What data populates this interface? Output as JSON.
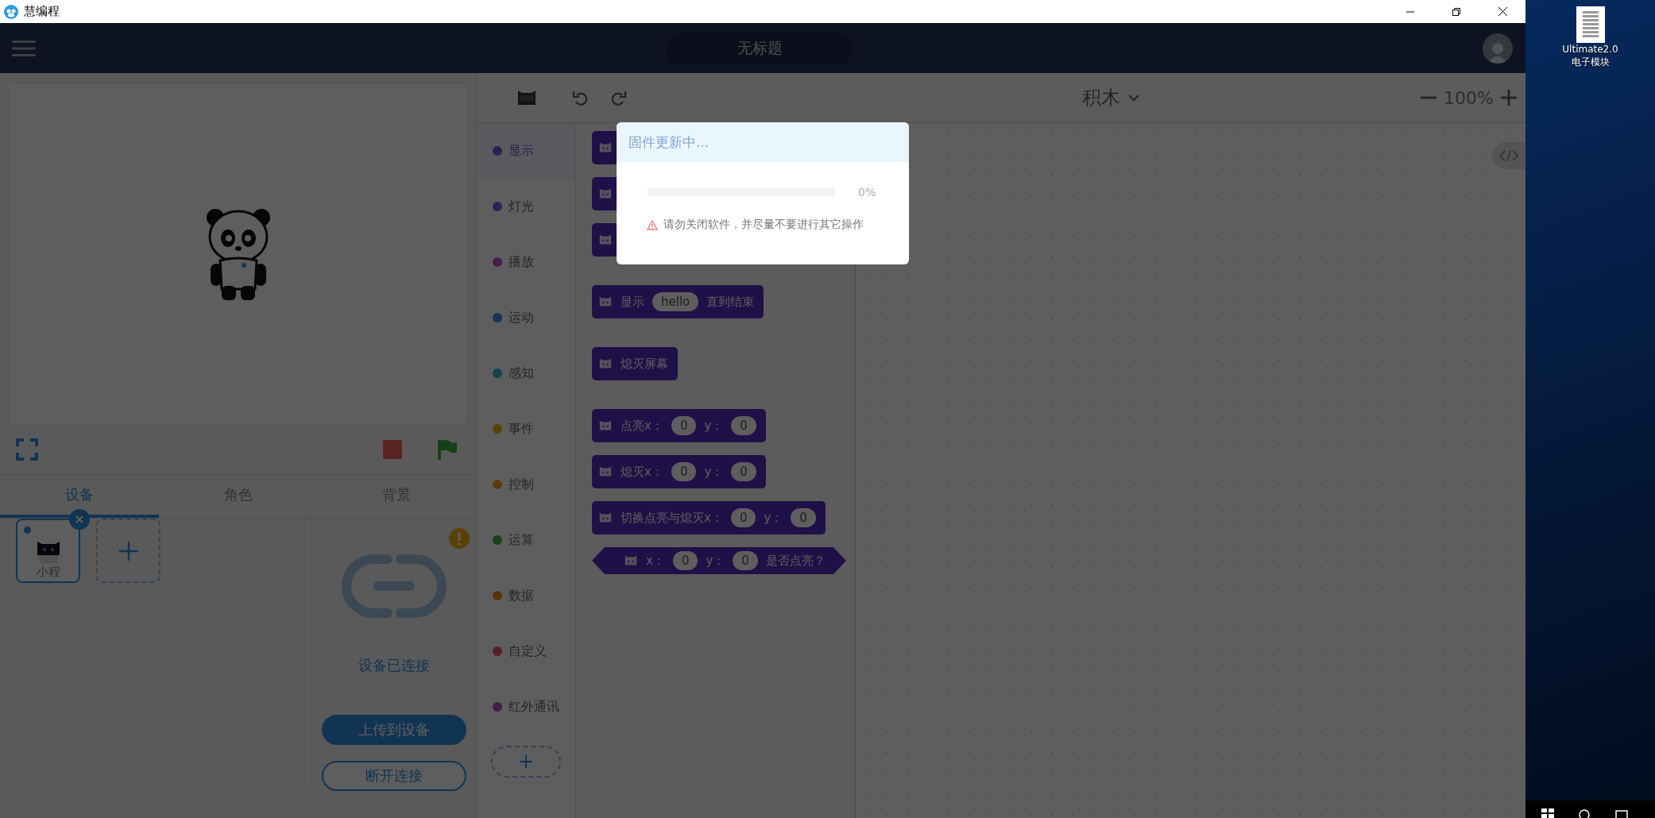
{
  "title_bar": {
    "app_name": "慧编程"
  },
  "header": {
    "project_title": "无标题"
  },
  "stage_tabs": [
    {
      "label": "设备",
      "selected": true
    },
    {
      "label": "角色",
      "selected": false
    },
    {
      "label": "背景",
      "selected": false
    }
  ],
  "devices": [
    {
      "name": "小程",
      "selected": true
    }
  ],
  "connection": {
    "status": "设备已连接",
    "buttons": [
      {
        "label": "上传到设备",
        "kind": "primary"
      },
      {
        "label": "断开连接",
        "kind": "outline"
      }
    ]
  },
  "categories": [
    {
      "label": "显示",
      "color": "#2d1f53",
      "selected": true
    },
    {
      "label": "灯光",
      "color": "#302055",
      "selected": false
    },
    {
      "label": "播放",
      "color": "#4a1d44",
      "selected": false
    },
    {
      "label": "运动",
      "color": "#153456",
      "selected": false
    },
    {
      "label": "感知",
      "color": "#13434d",
      "selected": false
    },
    {
      "label": "事件",
      "color": "#594300",
      "selected": false
    },
    {
      "label": "控制",
      "color": "#5a3d0d",
      "selected": false
    },
    {
      "label": "运算",
      "color": "#17421b",
      "selected": false
    },
    {
      "label": "数据",
      "color": "#59330a",
      "selected": false
    },
    {
      "label": "自定义",
      "color": "#581e29",
      "selected": false
    },
    {
      "label": "红外通讯",
      "color": "#411d4a",
      "selected": false
    }
  ],
  "editor": {
    "mode": "积木",
    "zoom": "100%"
  },
  "blocks": [
    {
      "kind": "covered"
    },
    {
      "kind": "covered"
    },
    {
      "kind": "covered"
    },
    {
      "kind": "stack",
      "parts": [
        {
          "kind": "text",
          "text": "显示"
        },
        {
          "kind": "input",
          "text": "hello"
        },
        {
          "kind": "text",
          "text": "直到结束"
        }
      ]
    },
    {
      "kind": "stack",
      "parts": [
        {
          "kind": "text",
          "text": "熄灭屏幕"
        }
      ]
    },
    {
      "kind": "stack",
      "parts": [
        {
          "kind": "text",
          "text": "点亮x："
        },
        {
          "kind": "input",
          "text": "0"
        },
        {
          "kind": "text",
          "text": "y："
        },
        {
          "kind": "input",
          "text": "0"
        }
      ]
    },
    {
      "kind": "stack",
      "parts": [
        {
          "kind": "text",
          "text": "熄灭x："
        },
        {
          "kind": "input",
          "text": "0"
        },
        {
          "kind": "text",
          "text": "y："
        },
        {
          "kind": "input",
          "text": "0"
        }
      ]
    },
    {
      "kind": "stack",
      "parts": [
        {
          "kind": "text",
          "text": "切换点亮与熄灭x："
        },
        {
          "kind": "input",
          "text": "0"
        },
        {
          "kind": "text",
          "text": "y："
        },
        {
          "kind": "input",
          "text": "0"
        }
      ]
    },
    {
      "kind": "boolean",
      "parts": [
        {
          "kind": "text",
          "text": "x："
        },
        {
          "kind": "input",
          "text": "0"
        },
        {
          "kind": "text",
          "text": "y："
        },
        {
          "kind": "input",
          "text": "0"
        },
        {
          "kind": "text",
          "text": "是否点亮？"
        }
      ]
    }
  ],
  "modal": {
    "title": "固件更新中...",
    "progress": {
      "level": 0,
      "reading": "0%"
    },
    "warning": "请勿关闭软件，并尽量不要进行其它操作"
  },
  "desktop": {
    "icon_label": [
      "Ultimate2.0",
      "电子模块"
    ]
  }
}
